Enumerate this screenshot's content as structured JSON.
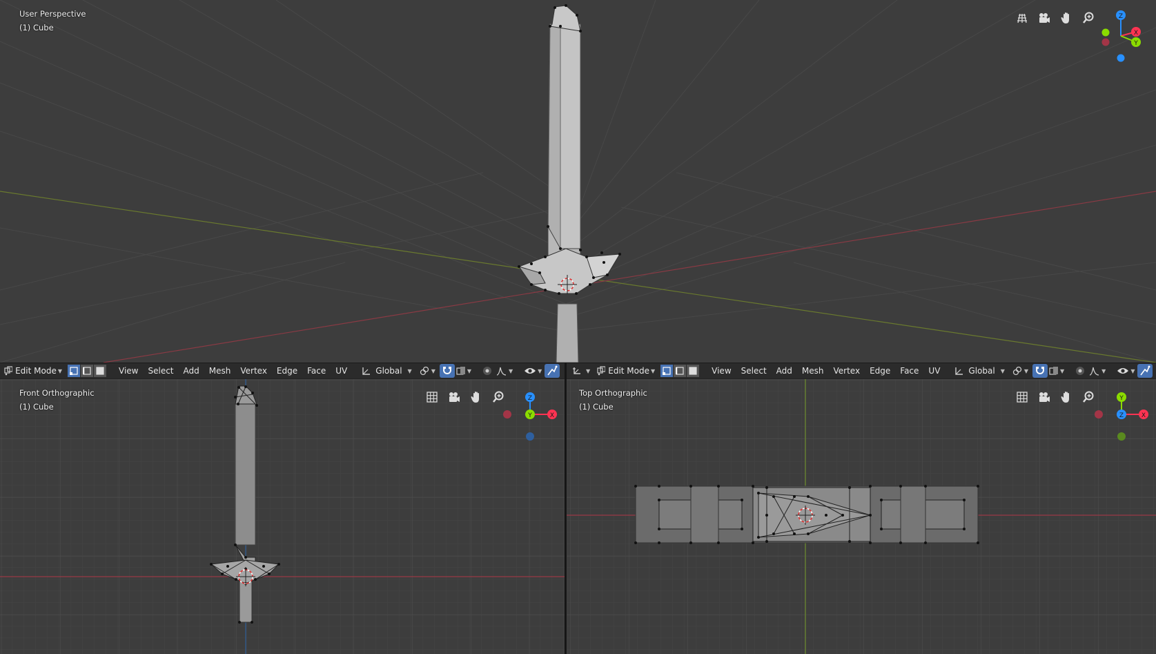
{
  "viewports": {
    "top": {
      "view_name": "User Perspective",
      "object_name": "(1) Cube"
    },
    "front": {
      "view_name": "Front Orthographic",
      "object_name": "(1) Cube"
    },
    "topo": {
      "view_name": "Top Orthographic",
      "object_name": "(1) Cube"
    }
  },
  "header": {
    "mode": "Edit Mode",
    "menus": [
      "View",
      "Select",
      "Add",
      "Mesh",
      "Vertex",
      "Edge",
      "Face",
      "UV"
    ],
    "transform_orientation": "Global"
  },
  "gizmo_axes": {
    "x": "X",
    "y": "Y",
    "z": "Z"
  },
  "colors": {
    "x_axis": "#ff3352",
    "y_axis": "#8bdc00",
    "z_axis": "#2890ff",
    "active_button": "#4772b3",
    "viewport_bg": "#3d3d3d",
    "header_bg": "#2b2b2b"
  },
  "icons": [
    "grid-icon",
    "camera-icon",
    "hand-icon",
    "zoom-icon",
    "eye-icon",
    "snap-icon",
    "proportional-icon"
  ]
}
